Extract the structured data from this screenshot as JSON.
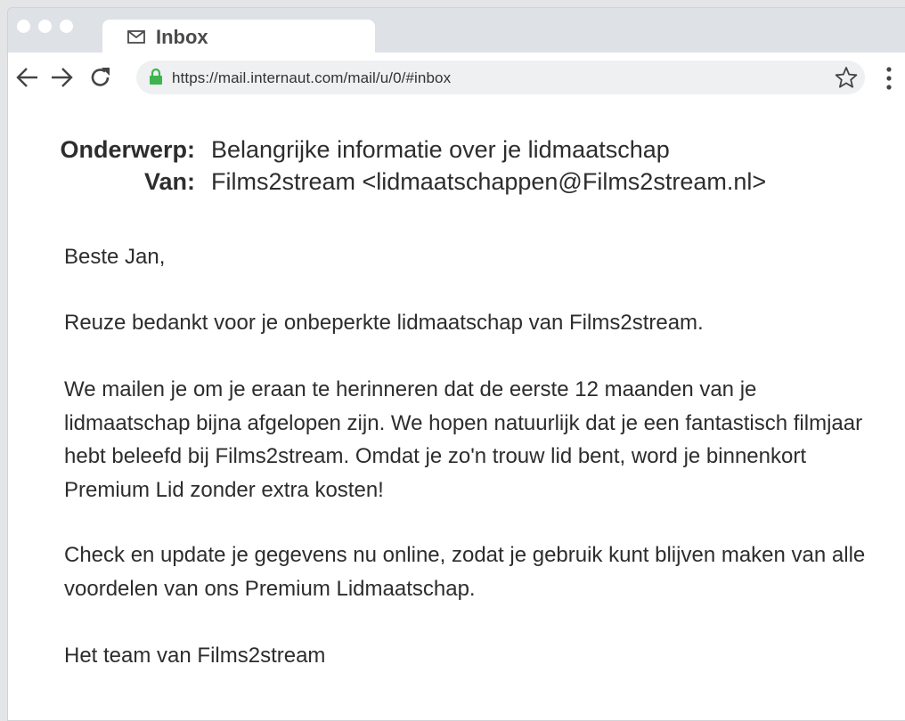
{
  "browser": {
    "tab_title": "Inbox",
    "url": "https://mail.internaut.com/mail/u/0/#inbox",
    "icons": [
      "mail-icon",
      "back-arrow-icon",
      "forward-arrow-icon",
      "reload-icon",
      "lock-icon",
      "star-icon",
      "more-vert-icon"
    ],
    "colors": {
      "lock": "#3fb34f",
      "frame": "#dee1e6"
    }
  },
  "email": {
    "subject_label": "Onderwerp:",
    "subject": "Belangrijke informatie over je lidmaatschap",
    "from_label": "Van:",
    "from": "Films2stream <lidmaatschappen@Films2stream.nl>",
    "greeting": "Beste Jan,",
    "paragraphs": [
      "Reuze bedankt voor je onbeperkte lidmaatschap van Films2stream.",
      "We mailen je om je eraan te herinneren dat de eerste 12 maanden van je lidmaatschap bijna afgelopen zijn. We hopen natuurlijk dat je een fantastisch filmjaar hebt beleefd bij Films2stream. Omdat je zo'n trouw lid bent, word je binnenkort Premium Lid zonder extra kosten!",
      "Check en update je gegevens nu online, zodat je gebruik kunt blijven maken van alle voordelen van ons Premium Lidmaatschap."
    ],
    "signature": "Het team van Films2stream"
  }
}
